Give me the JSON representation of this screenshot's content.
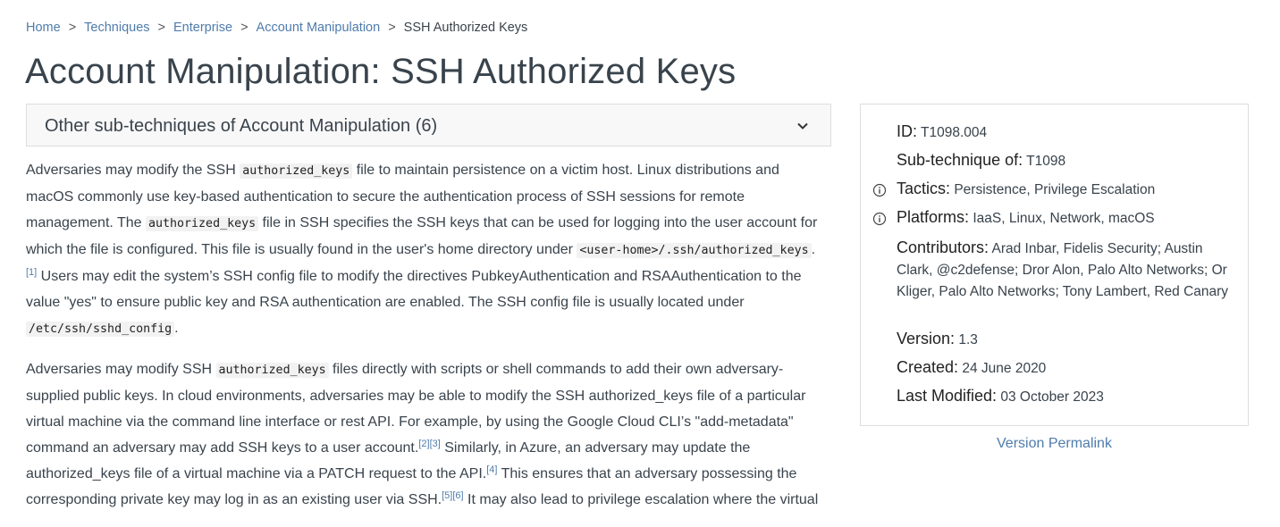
{
  "breadcrumb": {
    "items": [
      "Home",
      "Techniques",
      "Enterprise",
      "Account Manipulation"
    ],
    "separator": ">",
    "current": "SSH Authorized Keys"
  },
  "page_title": "Account Manipulation: SSH Authorized Keys",
  "accordion": {
    "label": "Other sub-techniques of Account Manipulation (6)",
    "icon": "chevron-down-icon"
  },
  "body": {
    "p1": {
      "t1": "Adversaries may modify the SSH ",
      "c1": "authorized_keys",
      "t2": " file to maintain persistence on a victim host. Linux distributions and macOS commonly use key-based authentication to secure the authentication process of SSH sessions for remote management. The ",
      "c2": "authorized_keys",
      "t3": " file in SSH specifies the SSH keys that can be used for logging into the user account for which the file is configured. This file is usually found in the user's home directory under ",
      "c3": "<user-home>/.ssh/authorized_keys",
      "t4": ".",
      "ref1": "[1]",
      "t5": " Users may edit the system’s SSH config file to modify the directives PubkeyAuthentication and RSAAuthentication to the value \"yes\" to ensure public key and RSA authentication are enabled. The SSH config file is usually located under ",
      "c4": "/etc/ssh/sshd_config",
      "t6": "."
    },
    "p2": {
      "t1": "Adversaries may modify SSH ",
      "c1": "authorized_keys",
      "t2": " files directly with scripts or shell commands to add their own adversary-supplied public keys. In cloud environments, adversaries may be able to modify the SSH authorized_keys file of a particular virtual machine via the command line interface or rest API. For example, by using the Google Cloud CLI’s \"add-metadata\" command an adversary may add SSH keys to a user account.",
      "ref2": "[2]",
      "ref3": "[3]",
      "t3": " Similarly, in Azure, an adversary may update the authorized_keys file of a virtual machine via a PATCH request to the API.",
      "ref4": "[4]",
      "t4": " This ensures that an adversary possessing the corresponding private key may log in as an existing user via SSH.",
      "ref5": "[5]",
      "ref6": "[6]",
      "t5": " It may also lead to privilege escalation where the virtual"
    }
  },
  "card": {
    "id_label": "ID:",
    "id_value": "T1098.004",
    "subtech_label": "Sub-technique of:",
    "subtech_value": "T1098",
    "tactics_label": "Tactics:",
    "tactic1": "Persistence",
    "tactic_sep": ",",
    "tactic2": "Privilege Escalation",
    "platforms_label": "Platforms:",
    "platforms_value": "IaaS, Linux, Network, macOS",
    "contributors_label": "Contributors:",
    "contributors_value": "Arad Inbar, Fidelis Security; Austin Clark, @c2defense; Dror Alon, Palo Alto Networks; Or Kliger, Palo Alto Networks; Tony Lambert, Red Canary",
    "version_label": "Version:",
    "version_value": "1.3",
    "created_label": "Created:",
    "created_value": "24 June 2020",
    "modified_label": "Last Modified:",
    "modified_value": "03 October 2023"
  },
  "permalink": "Version Permalink"
}
